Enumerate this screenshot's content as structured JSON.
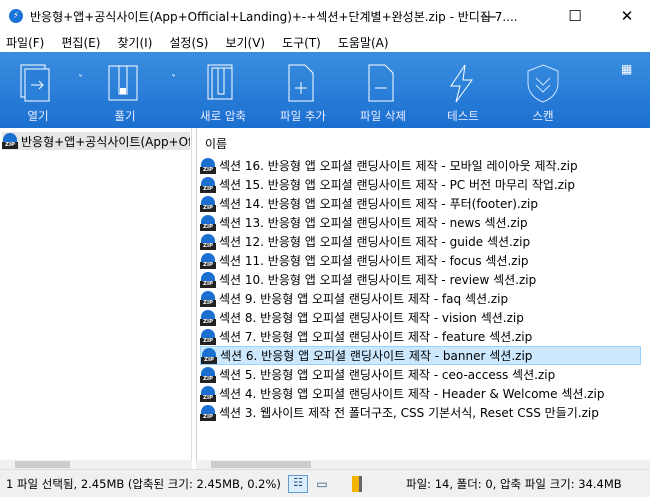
{
  "window": {
    "title": "반응형+앱+공식사이트(App+Official+Landing)+-+섹션+단계별+완성본.zip - 반디집 7....",
    "minimize": "—",
    "maximize": "☐",
    "close": "✕"
  },
  "menu": [
    "파일(F)",
    "편집(E)",
    "찾기(I)",
    "설정(S)",
    "보기(V)",
    "도구(T)",
    "도움말(A)"
  ],
  "toolbar": {
    "open": "열기",
    "extract": "풀기",
    "new_archive": "새로 압축",
    "add_file": "파일 추가",
    "delete_file": "파일 삭제",
    "test": "테스트",
    "scan": "스캔"
  },
  "tree": {
    "root": "반응형+앱+공식사이트(App+Official+Landing)+-+섹션+단계별+완성본.zip"
  },
  "list": {
    "column_name": "이름",
    "files": [
      "섹션 16. 반응형 앱 오피셜 랜딩사이트 제작 - 모바일 레이아웃 제작.zip",
      "섹션 15. 반응형 앱 오피셜 랜딩사이트 제작 - PC 버전 마무리 작업.zip",
      "섹션 14. 반응형 앱 오피셜 랜딩사이트 제작 - 푸터(footer).zip",
      "섹션 13. 반응형 앱 오피셜 랜딩사이트 제작 - news 섹션.zip",
      "섹션 12. 반응형 앱 오피셜 랜딩사이트 제작 - guide 섹션.zip",
      "섹션 11. 반응형 앱 오피셜 랜딩사이트 제작 - focus 섹션.zip",
      "섹션 10. 반응형 앱 오피셜 랜딩사이트 제작 - review 섹션.zip",
      "섹션 9. 반응형 앱 오피셜 랜딩사이트 제작 - faq 섹션.zip",
      "섹션 8. 반응형 앱 오피셜 랜딩사이트 제작 - vision 섹션.zip",
      "섹션 7. 반응형 앱 오피셜 랜딩사이트 제작 - feature 섹션.zip",
      "섹션 6. 반응형 앱 오피셜 랜딩사이트 제작 - banner 섹션.zip",
      "섹션 5. 반응형 앱 오피셜 랜딩사이트 제작 - ceo-access 섹션.zip",
      "섹션 4. 반응형 앱 오피셜 랜딩사이트 제작 - Header & Welcome 섹션.zip",
      "섹션 3. 웹사이트 제작 전 폴더구조, CSS 기본서식, Reset CSS 만들기.zip"
    ],
    "selected_index": 10
  },
  "status": {
    "selection": "1 파일 선택됨, 2.45MB (압축된 크기: 2.45MB, 0.2%)",
    "summary": "파일: 14, 폴더: 0, 압축 파일 크기: 34.4MB"
  },
  "colors": {
    "toolbar": "#1b6fd0",
    "selection": "#cce8ff"
  }
}
